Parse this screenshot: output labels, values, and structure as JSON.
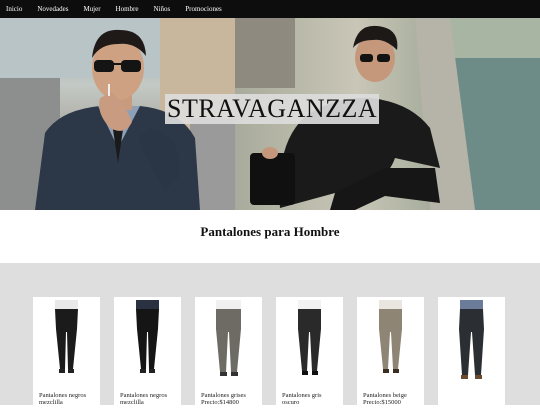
{
  "nav": {
    "items": [
      {
        "label": "Inicio"
      },
      {
        "label": "Novedades"
      },
      {
        "label": "Mujer"
      },
      {
        "label": "Hombre"
      },
      {
        "label": "Niños"
      },
      {
        "label": "Promociones"
      }
    ]
  },
  "hero": {
    "brand": "STRAVAGANZZA"
  },
  "section": {
    "title": "Pantalones para Hombre"
  },
  "products": [
    {
      "name": "Pantalones negros mezclilla",
      "color": "#1b1b1b",
      "shirt": "#e8e8e8"
    },
    {
      "name": "Pantalones negros mezclilla",
      "color": "#151515",
      "shirt": "#2a3140"
    },
    {
      "name": "Pantalones grises Precio:$14800",
      "color": "#6e6a64",
      "shirt": "#f0f0f0"
    },
    {
      "name": "Pantalones gris oscuro",
      "color": "#2a2a2a",
      "shirt": "#f2f2f2"
    },
    {
      "name": "Pantalones beige Precio:$15000",
      "color": "#8f8574",
      "shirt": "#e9e6e0"
    },
    {
      "name": "",
      "color": "#2b2f33",
      "shirt": "#6a7c99"
    }
  ]
}
